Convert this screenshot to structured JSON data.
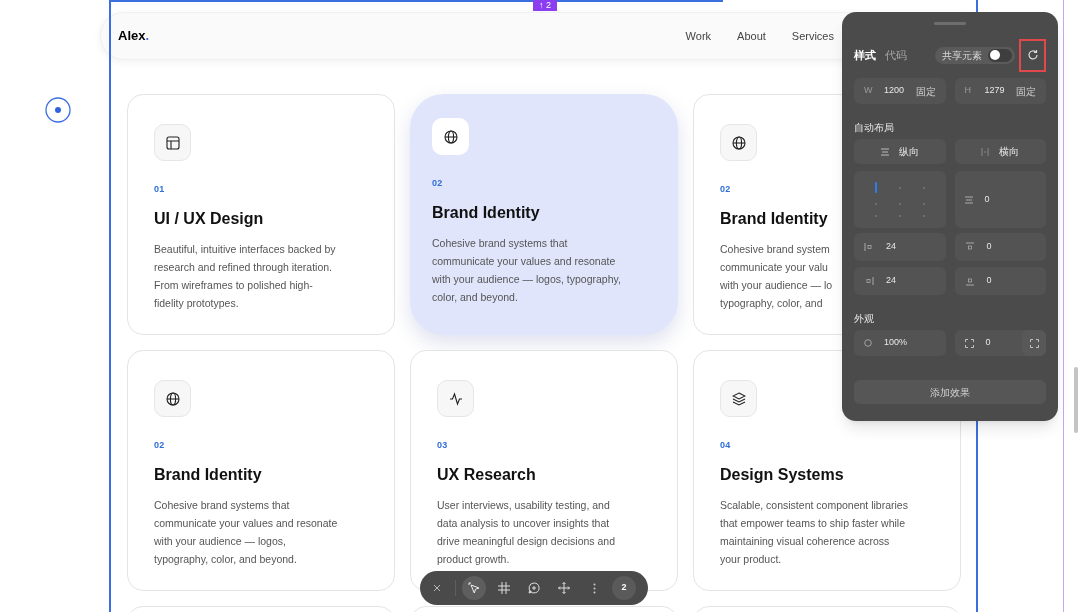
{
  "selection_badge": "↑ 2",
  "nav": {
    "logo": "Alex",
    "logo_dot": ".",
    "links": [
      "Work",
      "About",
      "Services"
    ]
  },
  "cards": [
    {
      "kind": "layout",
      "number": "01",
      "title": "UI / UX Design",
      "lines": [
        "Beautiful, intuitive interfaces backed by",
        "research and refined through iteration.",
        "From wireframes to polished high-",
        "fidelity prototypes."
      ],
      "highlighted": false
    },
    {
      "kind": "globe",
      "number": "02",
      "title": "Brand Identity",
      "lines": [
        "Cohesive brand systems that",
        "communicate your values and resonate",
        "with your audience — logos, typography,",
        "color, and beyond."
      ],
      "highlighted": true
    },
    {
      "kind": "globe",
      "number": "02",
      "title": "Brand Identity",
      "lines": [
        "Cohesive brand system",
        "communicate your valu",
        "with your audience — lo",
        "typography, color, and"
      ],
      "highlighted": false
    },
    {
      "kind": "globe",
      "number": "02",
      "title": "Brand Identity",
      "lines": [
        "Cohesive brand systems that",
        "communicate your values and resonate",
        "with your audience — logos,",
        "typography, color, and beyond."
      ],
      "highlighted": false
    },
    {
      "kind": "pulse",
      "number": "03",
      "title": "UX Research",
      "lines": [
        "User interviews, usability testing, and",
        "data analysis to uncover insights that",
        "drive meaningful design decisions and",
        "product growth."
      ],
      "highlighted": false
    },
    {
      "kind": "layers",
      "number": "04",
      "title": "Design Systems",
      "lines": [
        "Scalable, consistent component libraries",
        "that empower teams to ship faster while",
        "maintaining visual coherence across",
        "your product."
      ],
      "highlighted": false
    }
  ],
  "panel": {
    "tabs": [
      {
        "label": "样式",
        "selected": true
      },
      {
        "label": "代码",
        "selected": false
      }
    ],
    "share_toggle": {
      "label": "共享元素",
      "on": false
    },
    "reset_highlighted": true,
    "size": [
      {
        "axis": "W",
        "value": "1200",
        "mode": "固定"
      },
      {
        "axis": "H",
        "value": "1279",
        "mode": "固定"
      }
    ],
    "auto_layout": {
      "title": "自动布局",
      "directions": [
        "纵向",
        "横向"
      ],
      "alignment": [
        {
          "selected": true
        },
        {
          "selected": false
        },
        {
          "selected": false
        },
        {
          "selected": false
        },
        {
          "selected": false
        },
        {
          "selected": false
        },
        {
          "selected": false
        },
        {
          "selected": false
        },
        {
          "selected": false
        }
      ],
      "gap": "0",
      "padding": [
        {
          "kind": "left",
          "value": "24"
        },
        {
          "kind": "top",
          "value": "0"
        },
        {
          "kind": "right",
          "value": "24"
        },
        {
          "kind": "bottom",
          "value": "0"
        }
      ]
    },
    "appearance": {
      "title": "外观",
      "opacity": "100%",
      "radius": "0"
    },
    "add_effect": "添加效果"
  },
  "toolbar": {
    "count": "2"
  }
}
